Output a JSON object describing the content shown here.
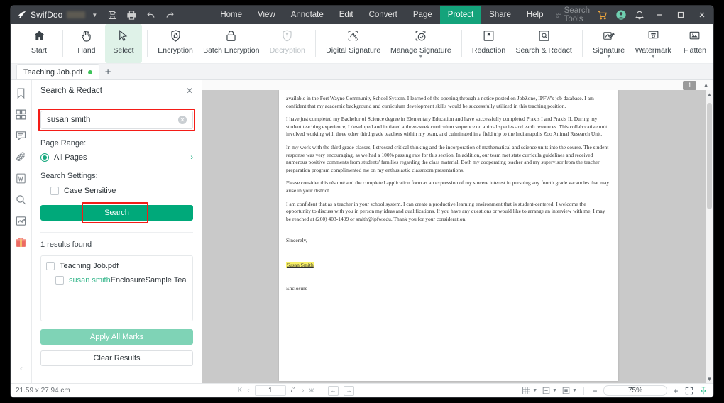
{
  "titlebar": {
    "brand": "SwifDoo",
    "quick_actions": [
      "save-icon",
      "print-icon",
      "undo-icon",
      "redo-icon"
    ],
    "menus": [
      {
        "label": "Home",
        "active": false
      },
      {
        "label": "View",
        "active": false
      },
      {
        "label": "Annotate",
        "active": false
      },
      {
        "label": "Edit",
        "active": false
      },
      {
        "label": "Convert",
        "active": false
      },
      {
        "label": "Page",
        "active": false
      },
      {
        "label": "Protect",
        "active": true
      },
      {
        "label": "Share",
        "active": false
      },
      {
        "label": "Help",
        "active": false
      }
    ],
    "search_tools_placeholder": "Search Tools",
    "window_controls": [
      "cart-icon",
      "account-icon",
      "bell-icon",
      "minimize-icon",
      "maximize-icon",
      "close-icon"
    ],
    "accent": "#14a37b",
    "bg": "#3c4046"
  },
  "ribbon": {
    "groups": [
      {
        "items": [
          {
            "label": "Start",
            "icon": "home-icon",
            "selected": false,
            "disabled": false,
            "caret": false
          }
        ]
      },
      {
        "items": [
          {
            "label": "Hand",
            "icon": "hand-icon",
            "selected": false,
            "disabled": false,
            "caret": false
          },
          {
            "label": "Select",
            "icon": "cursor-icon",
            "selected": true,
            "disabled": false,
            "caret": false
          }
        ]
      },
      {
        "items": [
          {
            "label": "Encryption",
            "icon": "shield-lock-icon",
            "selected": false,
            "disabled": false,
            "caret": false
          },
          {
            "label": "Batch Encryption",
            "icon": "padlock-icon",
            "selected": false,
            "disabled": false,
            "caret": false
          },
          {
            "label": "Decryption",
            "icon": "shield-key-icon",
            "selected": false,
            "disabled": true,
            "caret": false
          }
        ]
      },
      {
        "items": [
          {
            "label": "Digital Signature",
            "icon": "digital-signature-icon",
            "selected": false,
            "disabled": false,
            "caret": false
          },
          {
            "label": "Manage Signature",
            "icon": "manage-signature-icon",
            "selected": false,
            "disabled": false,
            "caret": true
          }
        ]
      },
      {
        "items": [
          {
            "label": "Redaction",
            "icon": "redaction-icon",
            "selected": false,
            "disabled": false,
            "caret": false
          },
          {
            "label": "Search & Redact",
            "icon": "search-redact-icon",
            "selected": false,
            "disabled": false,
            "caret": false
          }
        ]
      },
      {
        "items": [
          {
            "label": "Signature",
            "icon": "signature-icon",
            "selected": false,
            "disabled": false,
            "caret": true
          },
          {
            "label": "Watermark",
            "icon": "watermark-icon",
            "selected": false,
            "disabled": false,
            "caret": true
          },
          {
            "label": "Flatten",
            "icon": "flatten-icon",
            "selected": false,
            "disabled": false,
            "caret": false
          }
        ]
      }
    ]
  },
  "tabstrip": {
    "tabs": [
      {
        "label": "Teaching Job.pdf",
        "modified": true
      }
    ],
    "new_tab_label": "+"
  },
  "rail": {
    "icons": [
      "bookmark-icon",
      "thumbnails-icon",
      "comment-icon",
      "attachment-icon",
      "word-icon",
      "search-icon",
      "stamp-icon",
      "gift-icon"
    ],
    "collapse_label": "‹"
  },
  "panel": {
    "title": "Search & Redact",
    "close_label": "✕",
    "search": {
      "value": "susan smith",
      "placeholder": "Search",
      "clear_label": "✕"
    },
    "page_range_label": "Page Range:",
    "page_range_option": "All Pages",
    "page_range_chevron": "›",
    "search_settings_label": "Search Settings:",
    "case_sensitive_label": "Case Sensitive",
    "case_sensitive_checked": false,
    "search_button": "Search",
    "results_count": "1 results found",
    "results": [
      {
        "label": "Teaching Job.pdf",
        "highlight": "",
        "indent": false,
        "checked": false
      },
      {
        "label": "EnclosureSample Teacher Cov",
        "highlight": "susan smith",
        "indent": true,
        "checked": false
      }
    ],
    "apply_all_marks": "Apply All Marks",
    "clear_results": "Clear Results",
    "accent": "#00a97a",
    "annotation_color": "#f41c17"
  },
  "document": {
    "page_badge": "1",
    "paragraphs": [
      "available in the Fort Wayne Community School System. I learned of the opening through a notice posted on JobZone, IPFW's job database. I am confident that my academic background and curriculum development skills would be successfully utilized in this teaching position.",
      "I have just completed my Bachelor of Science degree in Elementary Education and have successfully completed Praxis I and Praxis II. During my student teaching experience, I developed and initiated a three-week curriculum sequence on animal species and earth resources. This collaborative unit involved working with three other third grade teachers within my team, and culminated in a field trip to the Indianapolis Zoo Animal Research Unit.",
      "In my work with the third grade classes, I stressed critical thinking and the incorporation of mathematical and science units into the course.  The student response was very encouraging, as we had a 100% passing rate for this section.  In addition, our team met state curricula guidelines and received numerous positive comments from students' families regarding the class material. Both my cooperating teacher and my supervisor from the teacher preparation program complimented me on my enthusiastic classroom presentations.",
      "Please consider this résumé and the completed application form as an expression of my sincere interest in pursuing any fourth grade vacancies that may arise in your district.",
      "I am confident that as a teacher in your school system, I can create a productive learning environment that is student-centered. I welcome the opportunity to discuss with you in person my ideas and qualifications. If you have any questions or would like to arrange an interview with me, I may be reached at (260) 403-1499 or smith@ipfw.edu. Thank you for your consideration."
    ],
    "closing": "Sincerely,",
    "signature": "Susan Smith",
    "signature_highlight_color": "#f7ef66",
    "enclosure": "Enclosure"
  },
  "statusbar": {
    "dimensions": "21.59 x 27.94 cm",
    "nav_first": "K",
    "nav_prev": "‹",
    "page_value": "1",
    "page_total": "/1",
    "nav_next": "›",
    "nav_last": "ж",
    "prev_view": "←",
    "next_view": "→",
    "view_modes": [
      "grid-view-icon",
      "single-page-icon",
      "continuous-page-icon"
    ],
    "zoom_out": "−",
    "zoom_level": "75%",
    "zoom_in": "+",
    "fullscreen": "fullscreen-icon",
    "pin": "pin-icon"
  }
}
